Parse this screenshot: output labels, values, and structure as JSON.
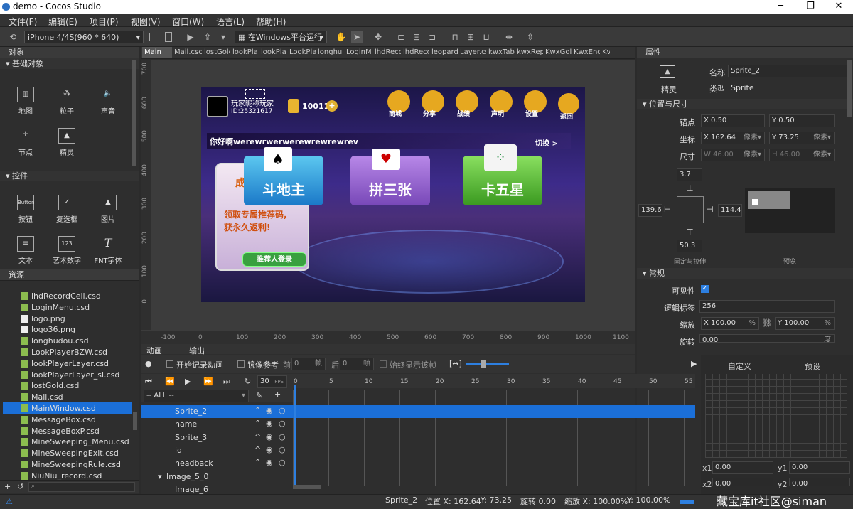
{
  "window": {
    "title": "demo - Cocos Studio",
    "minimize": "─",
    "maximize": "❐",
    "close": "✕"
  },
  "menu": [
    "文件(F)",
    "编辑(E)",
    "项目(P)",
    "视图(V)",
    "窗口(W)",
    "语言(L)",
    "帮助(H)"
  ],
  "toolbar": {
    "resolution": "iPhone 4/4S(960 * 640)",
    "run_target": "在Windows平台运行"
  },
  "objects_panel": {
    "title": "对象",
    "basic_section": "基础对象",
    "basic": [
      "地图",
      "粒子",
      "声音",
      "节点",
      "精灵"
    ],
    "controls_section": "控件",
    "controls": [
      "按钮",
      "复选框",
      "图片",
      "文本",
      "艺术数字",
      "FNT字体"
    ],
    "button_icon_text": "Button",
    "art_icon_text": "123"
  },
  "resources_panel": {
    "title": "资源",
    "items": [
      {
        "name": "lhdRecordCell.csd",
        "kind": "csd"
      },
      {
        "name": "LoginMenu.csd",
        "kind": "csd"
      },
      {
        "name": "logo.png",
        "kind": "png"
      },
      {
        "name": "logo36.png",
        "kind": "png"
      },
      {
        "name": "longhudou.csd",
        "kind": "csd"
      },
      {
        "name": "LookPlayerBZW.csd",
        "kind": "csd"
      },
      {
        "name": "lookPlayerLayer.csd",
        "kind": "csd"
      },
      {
        "name": "lookPlayerLayer_sl.csd",
        "kind": "csd"
      },
      {
        "name": "lostGold.csd",
        "kind": "csd"
      },
      {
        "name": "Mail.csd",
        "kind": "csd"
      },
      {
        "name": "MainWindow.csd",
        "kind": "csd",
        "selected": true
      },
      {
        "name": "MessageBox.csd",
        "kind": "csd"
      },
      {
        "name": "MessageBoxP.csd",
        "kind": "csd"
      },
      {
        "name": "MineSweeping_Menu.csd",
        "kind": "csd"
      },
      {
        "name": "MineSweepingExit.csd",
        "kind": "csd"
      },
      {
        "name": "MineSweepingRule.csd",
        "kind": "csd"
      },
      {
        "name": "NiuNiu_record.csd",
        "kind": "csd"
      }
    ]
  },
  "tabs": [
    "Main",
    "Mail.csc",
    "lostGolc",
    "lookPla",
    "lookPla",
    "LookPla",
    "longhu",
    "LoginM",
    "lhdReco",
    "lhdReco",
    "leopard",
    "Layer.cs",
    "kwxTabl",
    "kwxRep",
    "KwxGol",
    "KwxEnd",
    "Kv"
  ],
  "ruler": {
    "x": [
      "-100",
      "0",
      "100",
      "200",
      "300",
      "400",
      "500",
      "600",
      "700",
      "800",
      "900",
      "1000",
      "1100",
      "1200"
    ],
    "y": [
      "700",
      "600",
      "500",
      "400",
      "300",
      "200",
      "100",
      "0"
    ]
  },
  "game": {
    "player_label": "玩家昵称玩家",
    "player_id": "ID:25321617",
    "gold": "100111",
    "buttons": [
      "商城",
      "分享",
      "战绩",
      "声明",
      "设置",
      "返回"
    ],
    "greeting": "你好啊werewrwerwerewrewrewrev",
    "switch": "切换 >",
    "left_title": "成",
    "promo_line1": "领取专属推荐码,",
    "promo_line2": "获永久返利!",
    "login_button": "推荐人登录",
    "games": [
      "斗地主",
      "拼三张",
      "卡五星"
    ]
  },
  "properties_panel": {
    "title": "属性",
    "sprite_label": "精灵",
    "name_label": "名称",
    "name_value": "Sprite_2",
    "type_label": "类型",
    "type_value": "Sprite",
    "pos_section": "位置与尺寸",
    "anchor_label": "锚点",
    "anchor_x": "X 0.50",
    "anchor_y": "Y 0.50",
    "pos_label": "坐标",
    "pos_x": "X 162.64",
    "pos_y": "Y 73.25",
    "pos_unit": "像素▾",
    "size_label": "尺寸",
    "size_w": "W 46.00",
    "size_h": "H 46.00",
    "margin_top": "3.7",
    "margin_left": "139.6",
    "margin_right": "114.4",
    "margin_bottom": "50.3",
    "fixed_label": "固定与拉伸",
    "preview_label": "预览",
    "general_section": "常规",
    "visible_label": "可见性",
    "tag_label": "逻辑标签",
    "tag_value": "256",
    "scale_label": "缩放",
    "scale_x": "X 100.00",
    "scale_y": "Y 100.00",
    "percent": "%",
    "rotation_label": "旋转",
    "rotation_value": "0.00",
    "degree": "度"
  },
  "animation_panel": {
    "tab_anim": "动画",
    "tab_output": "输出",
    "record_label": "开始记录动画",
    "mirror_label": "镜像参考",
    "before_label": "前",
    "before_value": "0",
    "frame": "帧",
    "after_label": "后",
    "after_value": "0",
    "always_show_label": "始终显示该帧",
    "fps_value": "30",
    "fps": "FPS",
    "filter": "-- ALL --",
    "frames": [
      "0",
      "5",
      "10",
      "15",
      "20",
      "25",
      "30",
      "35",
      "40",
      "45",
      "50",
      "55"
    ],
    "rows": [
      {
        "name": "Sprite_2",
        "indent": 1,
        "selected": true
      },
      {
        "name": "name",
        "indent": 1
      },
      {
        "name": "Sprite_3",
        "indent": 1
      },
      {
        "name": "id",
        "indent": 1
      },
      {
        "name": "headback",
        "indent": 1
      },
      {
        "name": "Image_5_0",
        "indent": 0,
        "expand": true
      },
      {
        "name": "Image_6",
        "indent": 1
      }
    ],
    "custom_tab": "自定义",
    "preset_tab": "预设",
    "x1_label": "x1",
    "x1": "0.00",
    "y1_label": "y1",
    "y1": "0.00",
    "x2_label": "x2",
    "x2": "0.00",
    "y2_label": "y2",
    "y2": "0.00"
  },
  "status": {
    "node": "Sprite_2",
    "position": "位置 X: 162.64",
    "position_y": "Y: 73.25",
    "rotation": "旋转 0.00",
    "scale": "缩放 X: 100.00%",
    "scale_y": "Y: 100.00%",
    "watermark": "藏宝库it社区@siman"
  },
  "colors": {
    "accent": "#2d7fe0",
    "selected_row": "#1b6fd8",
    "panel_bg": "#2b2b2b",
    "header_bg": "#3a3a3a"
  }
}
